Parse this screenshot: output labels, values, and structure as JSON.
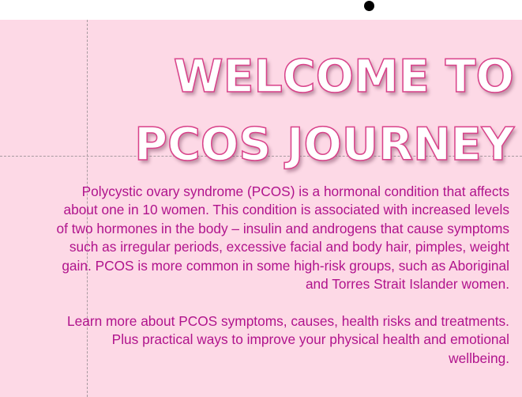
{
  "title": {
    "line1": "WELCOME TO",
    "line2": "PCOS JOURNEY"
  },
  "paragraph1": [
    "Polycystic ovary syndrome (PCOS) is a hormonal condition that affects",
    "about one in 10 women. This condition is associated with increased levels",
    "of two hormones in the body – insulin and androgens that cause symptoms",
    "such as irregular periods, excessive facial and body hair, pimples, weight",
    "gain. PCOS is more common in some high-risk groups, such as Aboriginal",
    "and Torres Strait Islander women."
  ],
  "paragraph2": [
    "Learn more about PCOS symptoms, causes, health risks and treatments.",
    "Plus practical ways to improve your physical health and emotional",
    "wellbeing."
  ],
  "colors": {
    "background": "#fdd9e6",
    "title_outline": "#d9428a",
    "body_text": "#b0138c"
  }
}
